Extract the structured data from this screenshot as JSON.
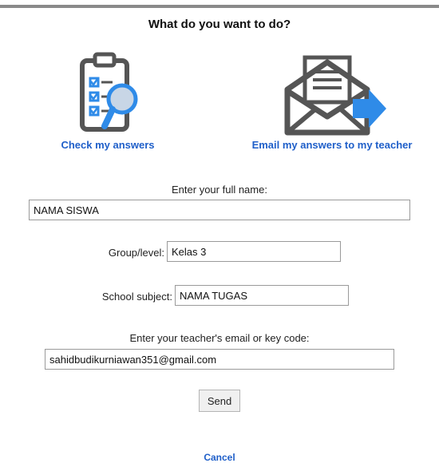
{
  "dialog": {
    "title": "What do you want to do?"
  },
  "options": {
    "check": {
      "label": "Check my answers",
      "icon": "clipboard-magnifier-icon"
    },
    "email": {
      "label": "Email my answers to my teacher",
      "icon": "envelope-send-icon"
    }
  },
  "form": {
    "full_name": {
      "caption": "Enter your full name:",
      "value": "NAMA SISWA"
    },
    "group": {
      "caption": "Group/level:",
      "value": "Kelas 3"
    },
    "subject": {
      "caption": "School subject:",
      "value": "NAMA TUGAS"
    },
    "email": {
      "caption": "Enter your teacher's email or key code:",
      "value": "sahidbudikurniawan351@gmail.com"
    },
    "send_label": "Send",
    "cancel_label": "Cancel"
  },
  "colors": {
    "accent": "#1f5fc9",
    "icon_gray": "#555555",
    "check_blue": "#2f8be8"
  }
}
